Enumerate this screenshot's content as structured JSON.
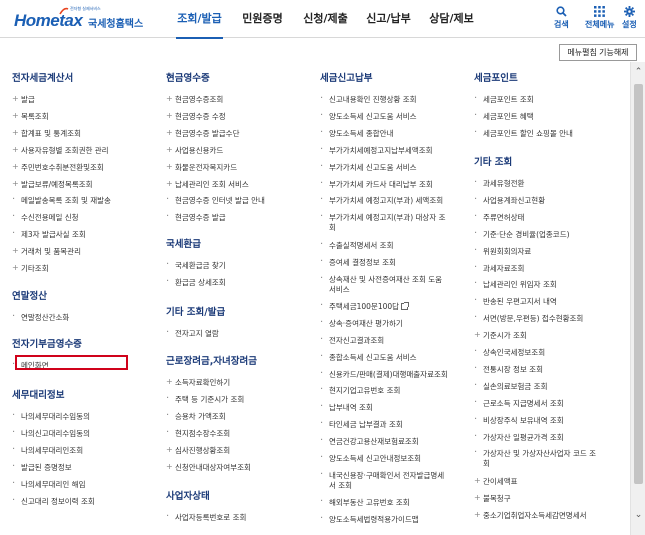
{
  "header": {
    "logo_main": "Hometax",
    "logo_sub": "국세청홈택스",
    "logo_tag": "전자형 실제서비스",
    "nav": [
      "조회/발급",
      "민원증명",
      "신청/제출",
      "신고/납부",
      "상담/제보"
    ],
    "active_nav": 0,
    "util": [
      {
        "label": "검색",
        "icon": "search-icon"
      },
      {
        "label": "전체메뉴",
        "icon": "grid-menu-icon"
      },
      {
        "label": "설정",
        "icon": "gear-icon"
      }
    ],
    "accent_color": "#1b5fb4"
  },
  "toolbar": {
    "feature_button": "메뉴펼침 기능해제"
  },
  "columns": [
    {
      "sections": [
        {
          "title": "전자세금계산서",
          "items": [
            {
              "t": "발급",
              "m": "plus"
            },
            {
              "t": "목록조회",
              "m": "plus"
            },
            {
              "t": "합계표 및 통계조회",
              "m": "plus"
            },
            {
              "t": "사용자유형별 조회권한 관리",
              "m": "plus"
            },
            {
              "t": "주민번호수취분전환및조회",
              "m": "plus"
            },
            {
              "t": "발급보류/예정목록조회",
              "m": "plus"
            },
            {
              "t": "메일발송목록 조회 및 재발송",
              "m": "dot"
            },
            {
              "t": "수신전용메일 신청",
              "m": "dot"
            },
            {
              "t": "제3자 발급사실 조회",
              "m": "dot"
            },
            {
              "t": "거래처 및 품목관리",
              "m": "plus"
            },
            {
              "t": "기타조회",
              "m": "plus"
            }
          ]
        },
        {
          "title": "연말정산",
          "items": [
            {
              "t": "연말정산간소화",
              "m": "dot"
            }
          ]
        },
        {
          "title": "전자기부금영수증",
          "items": [
            {
              "t": "메인화면",
              "m": "dot"
            }
          ]
        },
        {
          "title": "세무대리정보",
          "items": [
            {
              "t": "나의세무대리수임동의",
              "m": "dot"
            },
            {
              "t": "나의신고대리수임동의",
              "m": "dot"
            },
            {
              "t": "나의세무대리인조회",
              "m": "dot"
            },
            {
              "t": "발급된 증명정보",
              "m": "dot"
            },
            {
              "t": "나의세무대리인 해임",
              "m": "dot"
            },
            {
              "t": "신고대리 정보이력 조회",
              "m": "dot"
            }
          ]
        }
      ]
    },
    {
      "sections": [
        {
          "title": "현금영수증",
          "items": [
            {
              "t": "현금영수증조회",
              "m": "plus"
            },
            {
              "t": "현금영수증 수정",
              "m": "plus"
            },
            {
              "t": "현금영수증 발급수단",
              "m": "plus"
            },
            {
              "t": "사업용신용카드",
              "m": "plus"
            },
            {
              "t": "화물운전자복지카드",
              "m": "plus"
            },
            {
              "t": "납세관리인 조회 서비스",
              "m": "plus"
            },
            {
              "t": "현금영수증 인터넷 발급 안내",
              "m": "dot"
            },
            {
              "t": "현금영수증 발급",
              "m": "dot"
            }
          ]
        },
        {
          "title": "국세환급",
          "items": [
            {
              "t": "국세환급금 찾기",
              "m": "dot"
            },
            {
              "t": "환급금 상세조회",
              "m": "dot"
            }
          ]
        },
        {
          "title": "기타 조회/발급",
          "items": [
            {
              "t": "전자고지 열람",
              "m": "dot"
            }
          ]
        },
        {
          "title": "근로장려금,자녀장려금",
          "items": [
            {
              "t": "소득자료확인하기",
              "m": "plus"
            },
            {
              "t": "주택 등 기준시가 조회",
              "m": "dot"
            },
            {
              "t": "승용차 가액조회",
              "m": "dot"
            },
            {
              "t": "현지점수장수조회",
              "m": "dot"
            },
            {
              "t": "심사진행상황조회",
              "m": "plus"
            },
            {
              "t": "신청안내대상자여부조회",
              "m": "plus"
            }
          ]
        },
        {
          "title": "사업자상태",
          "items": [
            {
              "t": "사업자등록번호로 조회",
              "m": "dot"
            }
          ]
        }
      ]
    },
    {
      "sections": [
        {
          "title": "세금신고납부",
          "items": [
            {
              "t": "신고내용확인 진행상황 조회",
              "m": "dot"
            },
            {
              "t": "양도소득세 신고도움 서비스",
              "m": "dot"
            },
            {
              "t": "양도소득세 종합안내",
              "m": "dot"
            },
            {
              "t": "부가가치세예정고지납부세액조회",
              "m": "dot"
            },
            {
              "t": "부가가치세 신고도움 서비스",
              "m": "dot"
            },
            {
              "t": "부가가치세 카드사 대리납부 조회",
              "m": "dot"
            },
            {
              "t": "부가가치세 예정고지(부과) 세액조회",
              "m": "dot"
            },
            {
              "t": "부가가치세 예정고지(부과) 대상자 조\n회",
              "m": "dot"
            },
            {
              "t": "수출실적명세서 조회",
              "m": "dot"
            },
            {
              "t": "증여세 결정정보 조회",
              "m": "dot"
            },
            {
              "t": "상속재산 및 사전증여재산 조회 도움\n서비스",
              "m": "dot"
            },
            {
              "t": "주택세금100문100답",
              "m": "dot",
              "ext": true
            },
            {
              "t": "상속·증여재산 평가하기",
              "m": "dot"
            },
            {
              "t": "전자신고결과조회",
              "m": "dot"
            },
            {
              "t": "종합소득세 신고도움 서비스",
              "m": "dot"
            },
            {
              "t": "신용카드/판매(결제)대행매출자료조회",
              "m": "dot"
            },
            {
              "t": "현지기업고유번호 조회",
              "m": "dot"
            },
            {
              "t": "납부내역 조회",
              "m": "dot"
            },
            {
              "t": "타인세금 납부결과 조회",
              "m": "dot"
            },
            {
              "t": "연금건강고용산재보험료조회",
              "m": "dot"
            },
            {
              "t": "양도소득세 신고안내정보조회",
              "m": "dot"
            },
            {
              "t": "내국신용장·구매확인서 전자발급명세\n서 조회",
              "m": "dot"
            },
            {
              "t": "해외부동산 고유번호 조회",
              "m": "dot"
            },
            {
              "t": "양도소득세법령적용가이드맵",
              "m": "dot"
            }
          ]
        }
      ]
    },
    {
      "sections": [
        {
          "title": "세금포인트",
          "items": [
            {
              "t": "세금포인트 조회",
              "m": "dot"
            },
            {
              "t": "세금포인트 혜택",
              "m": "dot"
            },
            {
              "t": "세금포인트 할인 쇼핑몰 안내",
              "m": "dot"
            }
          ]
        },
        {
          "title": "기타 조회",
          "items": [
            {
              "t": "과세유형전환",
              "m": "dot"
            },
            {
              "t": "사업용계좌신고현황",
              "m": "dot"
            },
            {
              "t": "주류면허상태",
              "m": "dot"
            },
            {
              "t": "기준·단순 경비율(업종코드)",
              "m": "dot"
            },
            {
              "t": "위원회회의자료",
              "m": "dot"
            },
            {
              "t": "과세자료조회",
              "m": "dot"
            },
            {
              "t": "납세관리인 위임자 조회",
              "m": "dot"
            },
            {
              "t": "반송된 우편고지서 내역",
              "m": "dot"
            },
            {
              "t": "서면(방문,우편등) 접수현황조회",
              "m": "dot"
            },
            {
              "t": "기준시가 조회",
              "m": "plus"
            },
            {
              "t": "상속인국세정보조회",
              "m": "dot"
            },
            {
              "t": "전통시장 정보 조회",
              "m": "dot"
            },
            {
              "t": "실손의료보험금 조회",
              "m": "dot"
            },
            {
              "t": "근로소득 지급명세서 조회",
              "m": "dot"
            },
            {
              "t": "비상장주식 보유내역 조회",
              "m": "dot"
            },
            {
              "t": "가상자산 일평균가격 조회",
              "m": "dot"
            },
            {
              "t": "가상자산 및 가상자산사업자 코드 조\n회",
              "m": "dot"
            },
            {
              "t": "간이세액표",
              "m": "plus"
            },
            {
              "t": "불복청구",
              "m": "plus"
            },
            {
              "t": "중소기업취업자소득세감면명세서",
              "m": "plus"
            }
          ]
        }
      ]
    }
  ]
}
